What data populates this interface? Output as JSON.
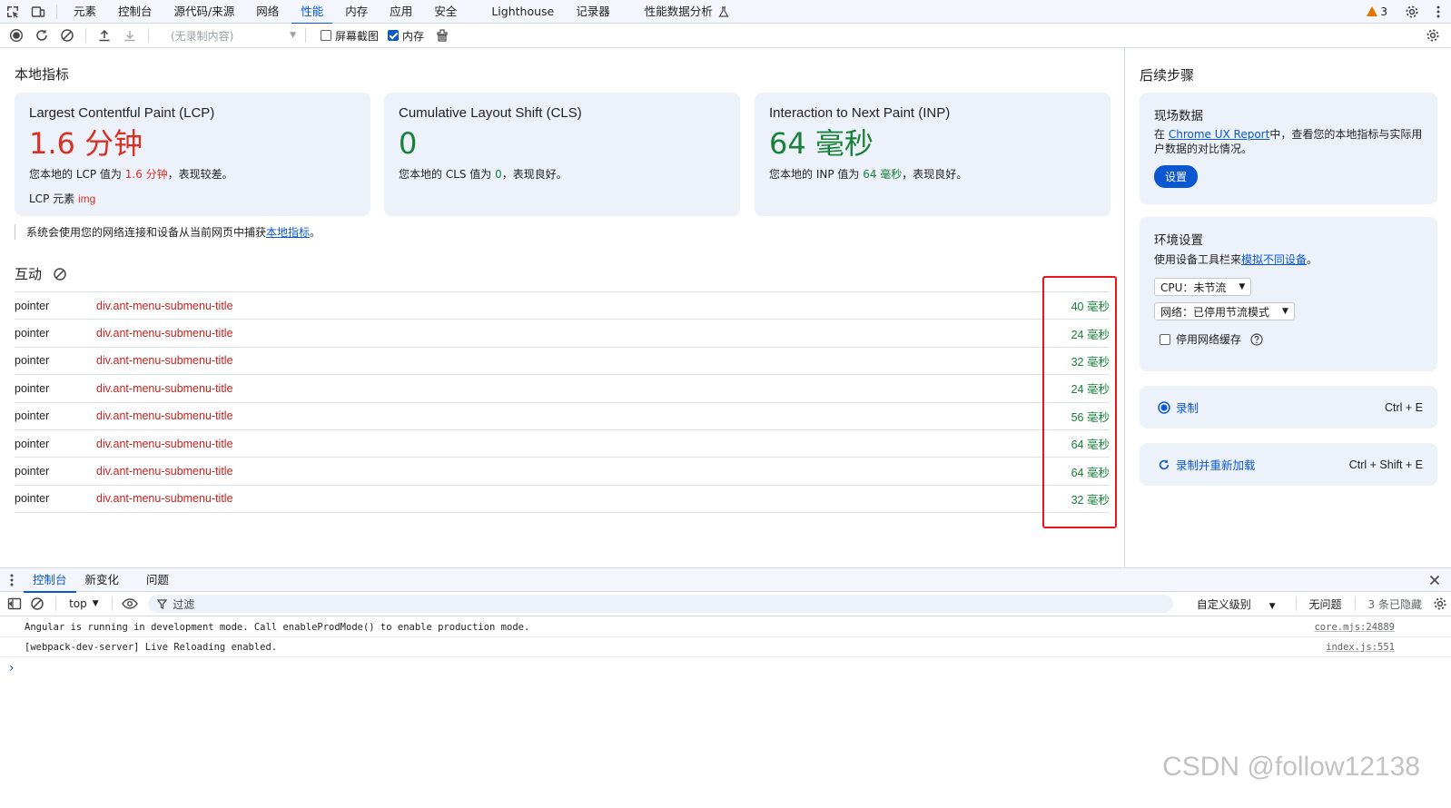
{
  "tabbar": {
    "tabs": [
      "元素",
      "控制台",
      "源代码/来源",
      "网络",
      "性能",
      "内存",
      "应用",
      "安全",
      "Lighthouse",
      "记录器",
      "性能数据分析"
    ],
    "active": "性能",
    "warnings_count": "3"
  },
  "toolbar": {
    "recording_select": "(无录制内容)",
    "screenshot_label": "屏幕截图",
    "memory_label": "内存",
    "screenshot_checked": false,
    "memory_checked": true
  },
  "local_metrics": {
    "title": "本地指标",
    "lcp": {
      "name": "Largest Contentful Paint (LCP)",
      "value": "1.6 分钟",
      "desc_prefix": "您本地的 LCP 值为 ",
      "desc_value": "1.6 分钟",
      "desc_suffix": "，表现较差。",
      "element_label": "LCP 元素",
      "element_value": "img",
      "color": "#d93025"
    },
    "cls": {
      "name": "Cumulative Layout Shift (CLS)",
      "value": "0",
      "desc_prefix": "您本地的 CLS 值为 ",
      "desc_value": "0",
      "desc_suffix": "，表现良好。",
      "color": "#188038"
    },
    "inp": {
      "name": "Interaction to Next Paint (INP)",
      "value": "64 毫秒",
      "desc_prefix": "您本地的 INP 值为 ",
      "desc_value": "64 毫秒",
      "desc_suffix": "，表现良好。",
      "color": "#188038"
    },
    "note_prefix": "系统会使用您的网络连接和设备从当前网页中捕获",
    "note_link": "本地指标",
    "note_suffix": "。"
  },
  "interactions": {
    "title": "互动",
    "rows": [
      {
        "type": "pointer",
        "element": "div.ant-menu-submenu-title",
        "duration": "40 毫秒"
      },
      {
        "type": "pointer",
        "element": "div.ant-menu-submenu-title",
        "duration": "24 毫秒"
      },
      {
        "type": "pointer",
        "element": "div.ant-menu-submenu-title",
        "duration": "32 毫秒"
      },
      {
        "type": "pointer",
        "element": "div.ant-menu-submenu-title",
        "duration": "24 毫秒"
      },
      {
        "type": "pointer",
        "element": "div.ant-menu-submenu-title",
        "duration": "56 毫秒"
      },
      {
        "type": "pointer",
        "element": "div.ant-menu-submenu-title",
        "duration": "64 毫秒"
      },
      {
        "type": "pointer",
        "element": "div.ant-menu-submenu-title",
        "duration": "64 毫秒"
      },
      {
        "type": "pointer",
        "element": "div.ant-menu-submenu-title",
        "duration": "32 毫秒"
      }
    ]
  },
  "next_steps": {
    "title": "后续步骤",
    "field": {
      "title": "现场数据",
      "desc_prefix": "在 ",
      "desc_link": "Chrome UX Report",
      "desc_suffix": "中，查看您的本地指标与实际用户数据的对比情况。",
      "button": "设置"
    },
    "env": {
      "title": "环境设置",
      "desc_prefix": "使用设备工具栏来",
      "desc_link": "模拟不同设备",
      "desc_suffix": "。",
      "cpu": "CPU：未节流",
      "network": "网络：已停用节流模式",
      "cache_label": "停用网络缓存"
    },
    "record": {
      "label": "录制",
      "shortcut": "Ctrl + E"
    },
    "reload": {
      "label": "录制并重新加载",
      "shortcut": "Ctrl + Shift + E"
    }
  },
  "drawer": {
    "tabs": [
      "控制台",
      "新变化",
      "问题"
    ],
    "context": "top",
    "filter_placeholder": "过滤",
    "level": "自定义级别",
    "issues": "无问题",
    "hidden": "3 条已隐藏",
    "messages": [
      {
        "text": "Angular is running in development mode. Call enableProdMode() to enable production mode.",
        "source": "core.mjs:24889"
      },
      {
        "text": "[webpack-dev-server] Live Reloading enabled.",
        "source": "index.js:551"
      }
    ],
    "prompt": "›"
  },
  "watermark": "CSDN @follow12138"
}
